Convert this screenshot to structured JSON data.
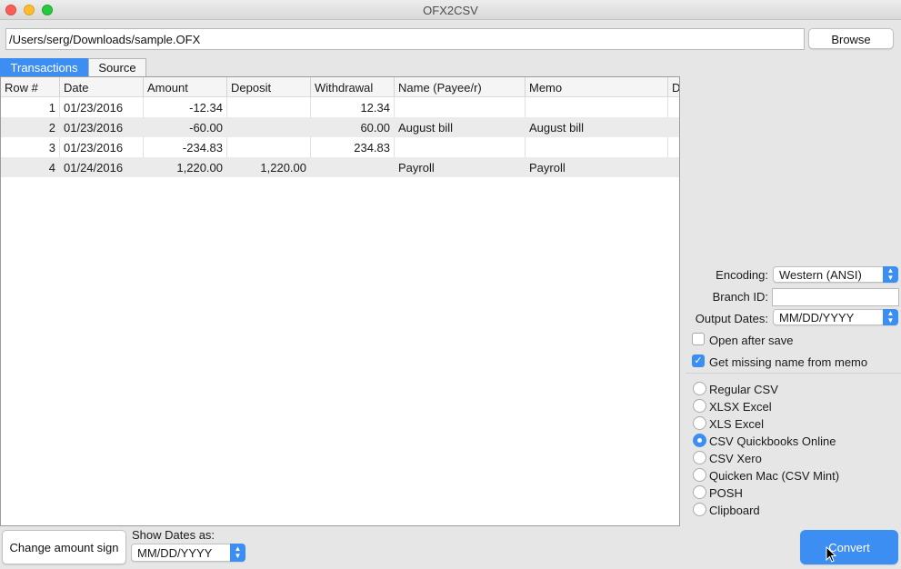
{
  "window": {
    "title": "OFX2CSV"
  },
  "file": {
    "path": "/Users/serg/Downloads/sample.OFX",
    "browse_label": "Browse"
  },
  "tabs": [
    {
      "label": "Transactions",
      "active": true
    },
    {
      "label": "Source",
      "active": false
    }
  ],
  "table": {
    "columns": [
      "Row #",
      "Date",
      "Amount",
      "Deposit",
      "Withdrawal",
      "Name (Payee/r)",
      "Memo",
      "D"
    ],
    "rows": [
      {
        "row": "1",
        "date": "01/23/2016",
        "amount": "-12.34",
        "deposit": "",
        "withdrawal": "12.34",
        "name": "",
        "memo": ""
      },
      {
        "row": "2",
        "date": "01/23/2016",
        "amount": "-60.00",
        "deposit": "",
        "withdrawal": "60.00",
        "name": "August bill",
        "memo": "August bill"
      },
      {
        "row": "3",
        "date": "01/23/2016",
        "amount": "-234.83",
        "deposit": "",
        "withdrawal": "234.83",
        "name": "",
        "memo": ""
      },
      {
        "row": "4",
        "date": "01/24/2016",
        "amount": "1,220.00",
        "deposit": "1,220.00",
        "withdrawal": "",
        "name": "Payroll",
        "memo": "Payroll"
      }
    ]
  },
  "settings": {
    "encoding_label": "Encoding:",
    "encoding_value": "Western (ANSI)",
    "branch_label": "Branch ID:",
    "branch_value": "",
    "output_dates_label": "Output Dates:",
    "output_dates_value": "MM/DD/YYYY",
    "open_after_save": {
      "label": "Open after save",
      "checked": false
    },
    "missing_name": {
      "label": "Get missing name from memo",
      "checked": true
    }
  },
  "formats": {
    "options": [
      "Regular CSV",
      "XLSX Excel",
      "XLS Excel",
      "CSV Quickbooks Online",
      "CSV Xero",
      "Quicken Mac (CSV Mint)",
      "POSH",
      "Clipboard"
    ],
    "selected": "CSV Quickbooks Online"
  },
  "bottom": {
    "change_sign_label": "Change amount sign",
    "show_dates_label": "Show Dates as:",
    "show_dates_value": "MM/DD/YYYY",
    "convert_label": "Convert"
  },
  "colors": {
    "accent": "#3d8ef2",
    "row_alt": "#ebebeb"
  }
}
